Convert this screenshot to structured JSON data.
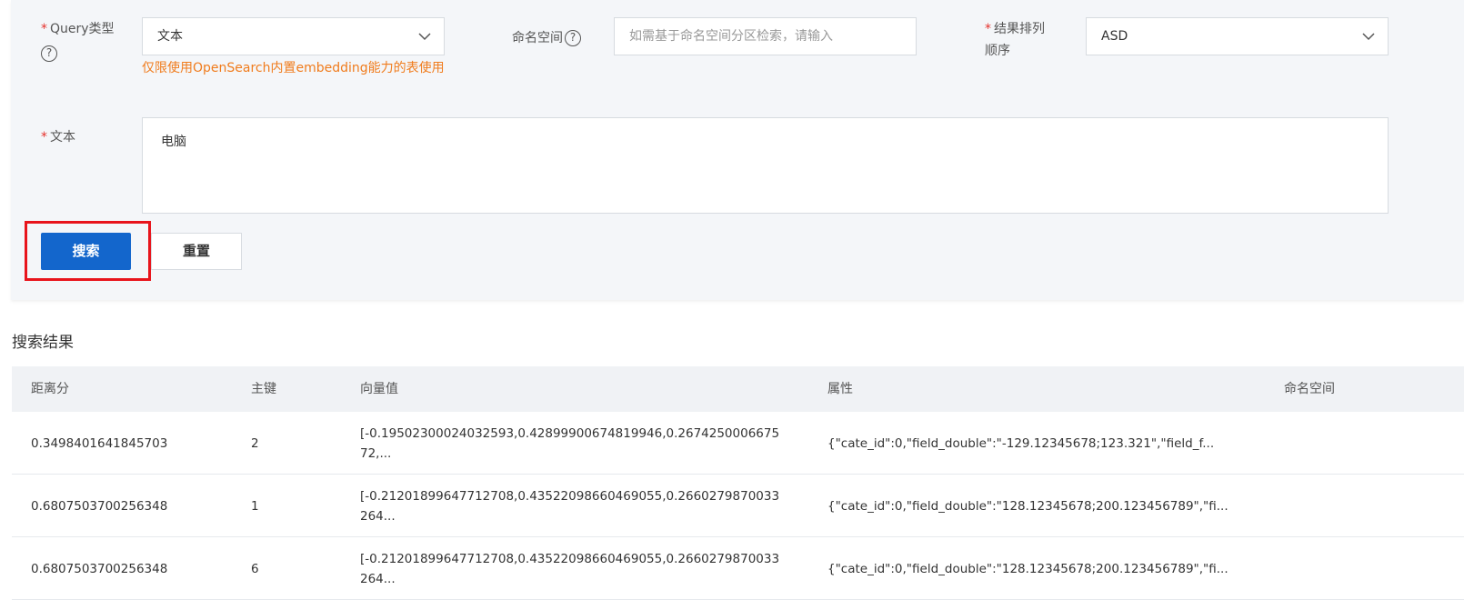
{
  "form": {
    "query_type": {
      "label": "Query类型",
      "value": "文本",
      "hint": "仅限使用OpenSearch内置embedding能力的表使用"
    },
    "namespace": {
      "label": "命名空间",
      "placeholder": "如需基于命名空间分区检索，请输入"
    },
    "sort_order": {
      "label_line1": "结果排列",
      "label_line2": "顺序",
      "value": "ASD"
    },
    "text": {
      "label": "文本",
      "value": "电脑"
    },
    "required_mark": "*",
    "help_glyph": "?"
  },
  "buttons": {
    "search": "搜索",
    "reset": "重置"
  },
  "results": {
    "title": "搜索结果",
    "columns": [
      "距离分",
      "主键",
      "向量值",
      "属性",
      "命名空间"
    ],
    "rows": [
      {
        "score": "0.3498401641845703",
        "pk": "2",
        "vector": "[-0.19502300024032593,0.42899900674819946,0.2674250006675\n72,...",
        "attrs": "{\"cate_id\":0,\"field_double\":\"-129.12345678;123.321\",\"field_f...",
        "namespace": ""
      },
      {
        "score": "0.6807503700256348",
        "pk": "1",
        "vector": "[-0.21201899647712708,0.43522098660469055,0.2660279870033\n264...",
        "attrs": "{\"cate_id\":0,\"field_double\":\"128.12345678;200.123456789\",\"fi...",
        "namespace": ""
      },
      {
        "score": "0.6807503700256348",
        "pk": "6",
        "vector": "[-0.21201899647712708,0.43522098660469055,0.2660279870033\n264...",
        "attrs": "{\"cate_id\":0,\"field_double\":\"128.12345678;200.123456789\",\"fi...",
        "namespace": ""
      }
    ]
  },
  "colors": {
    "primary": "#1366cc",
    "highlight": "#e8141c",
    "hint": "#f07c1d",
    "required": "#e5322d"
  }
}
